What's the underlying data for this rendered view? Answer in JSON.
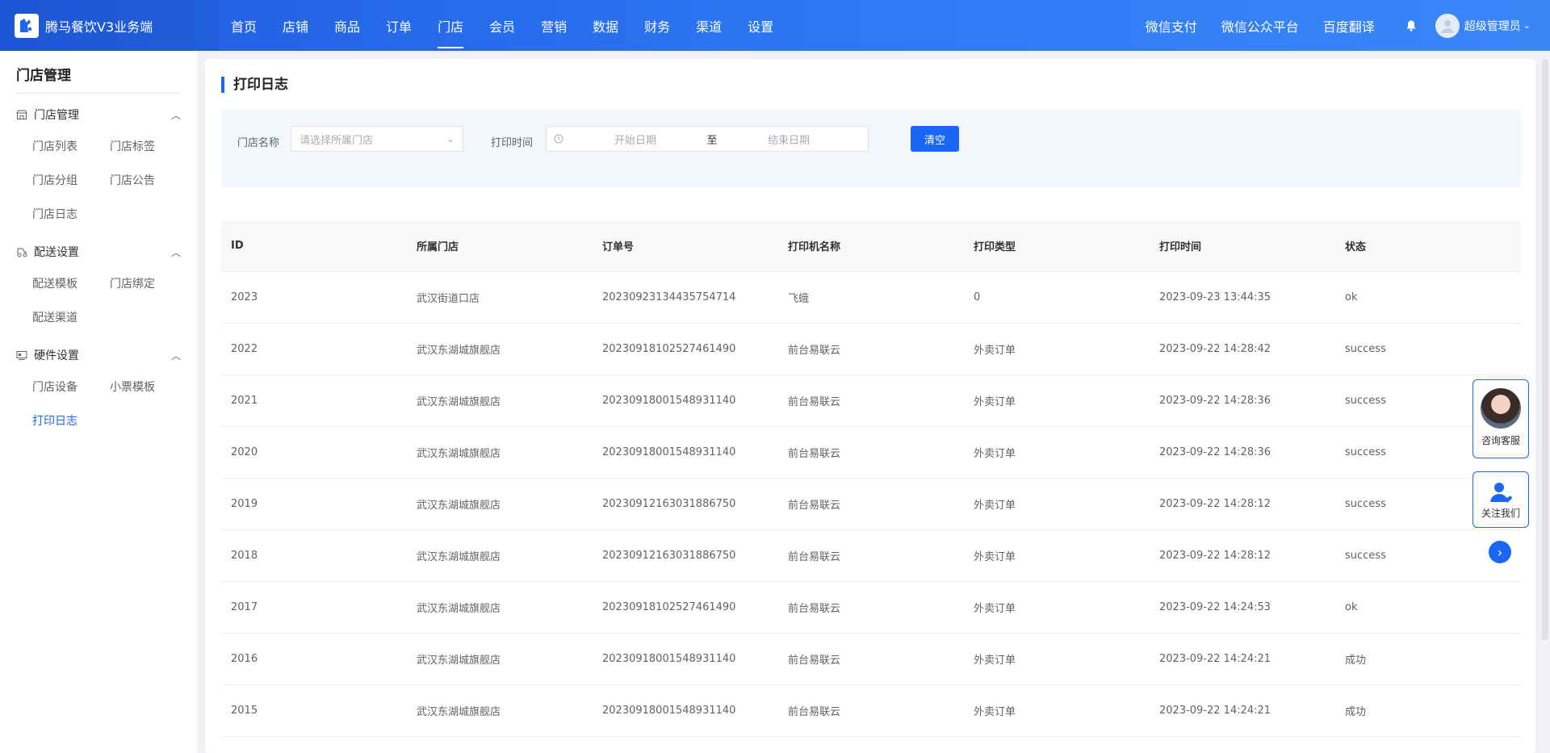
{
  "brand": {
    "title": "腾马餐饮V3业务端"
  },
  "nav": {
    "items": [
      {
        "label": "首页"
      },
      {
        "label": "店铺"
      },
      {
        "label": "商品"
      },
      {
        "label": "订单"
      },
      {
        "label": "门店",
        "active": true
      },
      {
        "label": "会员"
      },
      {
        "label": "营销"
      },
      {
        "label": "数据"
      },
      {
        "label": "财务"
      },
      {
        "label": "渠道"
      },
      {
        "label": "设置"
      }
    ],
    "right_links": [
      {
        "label": "微信支付"
      },
      {
        "label": "微信公众平台"
      },
      {
        "label": "百度翻译"
      }
    ],
    "user": "超级管理员"
  },
  "sidebar": {
    "title": "门店管理",
    "groups": [
      {
        "label": "门店管理",
        "icon": "store-icon",
        "items": [
          "门店列表",
          "门店标签",
          "门店分组",
          "门店公告",
          "门店日志"
        ]
      },
      {
        "label": "配送设置",
        "icon": "delivery-icon",
        "items": [
          "配送模板",
          "门店绑定",
          "配送渠道"
        ]
      },
      {
        "label": "硬件设置",
        "icon": "hardware-icon",
        "items": [
          "门店设备",
          "小票模板",
          "打印日志"
        ]
      }
    ],
    "active_item": "打印日志"
  },
  "page": {
    "title": "打印日志",
    "filter": {
      "store_label": "门店名称",
      "store_placeholder": "请选择所属门店",
      "time_label": "打印时间",
      "start_placeholder": "开始日期",
      "range_separator": "至",
      "end_placeholder": "结束日期",
      "clear_label": "清空"
    }
  },
  "table": {
    "columns": [
      "ID",
      "所属门店",
      "订单号",
      "打印机名称",
      "打印类型",
      "打印时间",
      "状态"
    ],
    "rows": [
      [
        "2023",
        "武汉街道口店",
        "2023092313443575471​4",
        "飞蛾",
        "0",
        "2023-09-23 13:44:35",
        "ok"
      ],
      [
        "2022",
        "武汉东湖城旗舰店",
        "20230918102527461490",
        "前台易联云",
        "外卖订单",
        "2023-09-22 14:28:42",
        "success"
      ],
      [
        "2021",
        "武汉东湖城旗舰店",
        "20230918001548931140",
        "前台易联云",
        "外卖订单",
        "2023-09-22 14:28:36",
        "success"
      ],
      [
        "2020",
        "武汉东湖城旗舰店",
        "20230918001548931140",
        "前台易联云",
        "外卖订单",
        "2023-09-22 14:28:36",
        "success"
      ],
      [
        "2019",
        "武汉东湖城旗舰店",
        "20230912163031886750",
        "前台易联云",
        "外卖订单",
        "2023-09-22 14:28:12",
        "success"
      ],
      [
        "2018",
        "武汉东湖城旗舰店",
        "20230912163031886750",
        "前台易联云",
        "外卖订单",
        "2023-09-22 14:28:12",
        "success"
      ],
      [
        "2017",
        "武汉东湖城旗舰店",
        "20230918102527461490",
        "前台易联云",
        "外卖订单",
        "2023-09-22 14:24:53",
        "ok"
      ],
      [
        "2016",
        "武汉东湖城旗舰店",
        "20230918001548931140",
        "前台易联云",
        "外卖订单",
        "2023-09-22 14:24:21",
        "成功"
      ],
      [
        "2015",
        "武汉东湖城旗舰店",
        "20230918001548931140",
        "前台易联云",
        "外卖订单",
        "2023-09-22 14:24:21",
        "成功"
      ]
    ]
  },
  "floating": {
    "consult_label": "咨询客服",
    "follow_label": "关注我们"
  },
  "colors": {
    "primary": "#1a66f5"
  }
}
